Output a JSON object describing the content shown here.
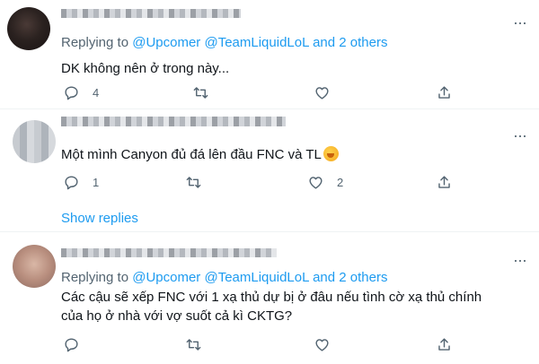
{
  "tweets": [
    {
      "replying_prefix": "Replying to",
      "mentions": [
        "@Upcomer",
        "@TeamLiquidLoL"
      ],
      "others": "and 2 others",
      "text": "DK không nên ở trong này...",
      "reply_count": "4",
      "retweet_count": "",
      "like_count": ""
    },
    {
      "text": "Một mình Canyon đủ đá lên đầu FNC và TL",
      "reply_count": "1",
      "retweet_count": "",
      "like_count": "2",
      "show_replies": "Show replies"
    },
    {
      "replying_prefix": "Replying to",
      "mentions": [
        "@Upcomer",
        "@TeamLiquidLoL"
      ],
      "others": "and 2 others",
      "text_line1": "Các cậu sẽ xếp FNC với 1 xạ thủ dự bị ở đâu nếu tình cờ xạ thủ chính",
      "text_line2": "của họ ở nhà với vợ suốt cả kì CKTG?",
      "reply_count": "",
      "retweet_count": "",
      "like_count": ""
    }
  ],
  "icons": [
    "reply-icon",
    "retweet-icon",
    "like-icon",
    "share-icon",
    "more-icon",
    "face-emoji-icon"
  ],
  "colors": {
    "link": "#1d9bf0",
    "muted": "#536471",
    "text": "#0f1419"
  }
}
